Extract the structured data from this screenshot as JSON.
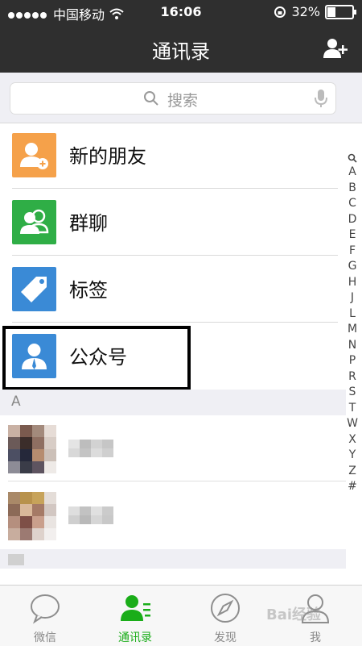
{
  "status": {
    "carrier": "中国移动",
    "time": "16:06",
    "battery": "32%",
    "battery_level": 0.32
  },
  "nav": {
    "title": "通讯录"
  },
  "search": {
    "placeholder": "搜索"
  },
  "entries": [
    {
      "label": "新的朋友",
      "color": "#f5a14a",
      "icon": "new-friend-icon"
    },
    {
      "label": "群聊",
      "color": "#2fae46",
      "icon": "group-chat-icon"
    },
    {
      "label": "标签",
      "color": "#3a8ad6",
      "icon": "tag-icon"
    },
    {
      "label": "公众号",
      "color": "#3a8ad6",
      "icon": "official-account-icon"
    }
  ],
  "section_header": "A",
  "index_letters": [
    "A",
    "B",
    "C",
    "D",
    "E",
    "F",
    "G",
    "H",
    "J",
    "L",
    "M",
    "N",
    "P",
    "R",
    "S",
    "T",
    "W",
    "X",
    "Y",
    "Z",
    "#"
  ],
  "tabs": [
    {
      "label": "微信",
      "icon": "chat-bubble-icon"
    },
    {
      "label": "通讯录",
      "icon": "contacts-icon"
    },
    {
      "label": "发现",
      "icon": "compass-icon"
    },
    {
      "label": "我",
      "icon": "person-icon"
    }
  ],
  "watermark": "Bai经验",
  "colors": {
    "bar": "#2f2f2f",
    "active": "#1aad19"
  }
}
